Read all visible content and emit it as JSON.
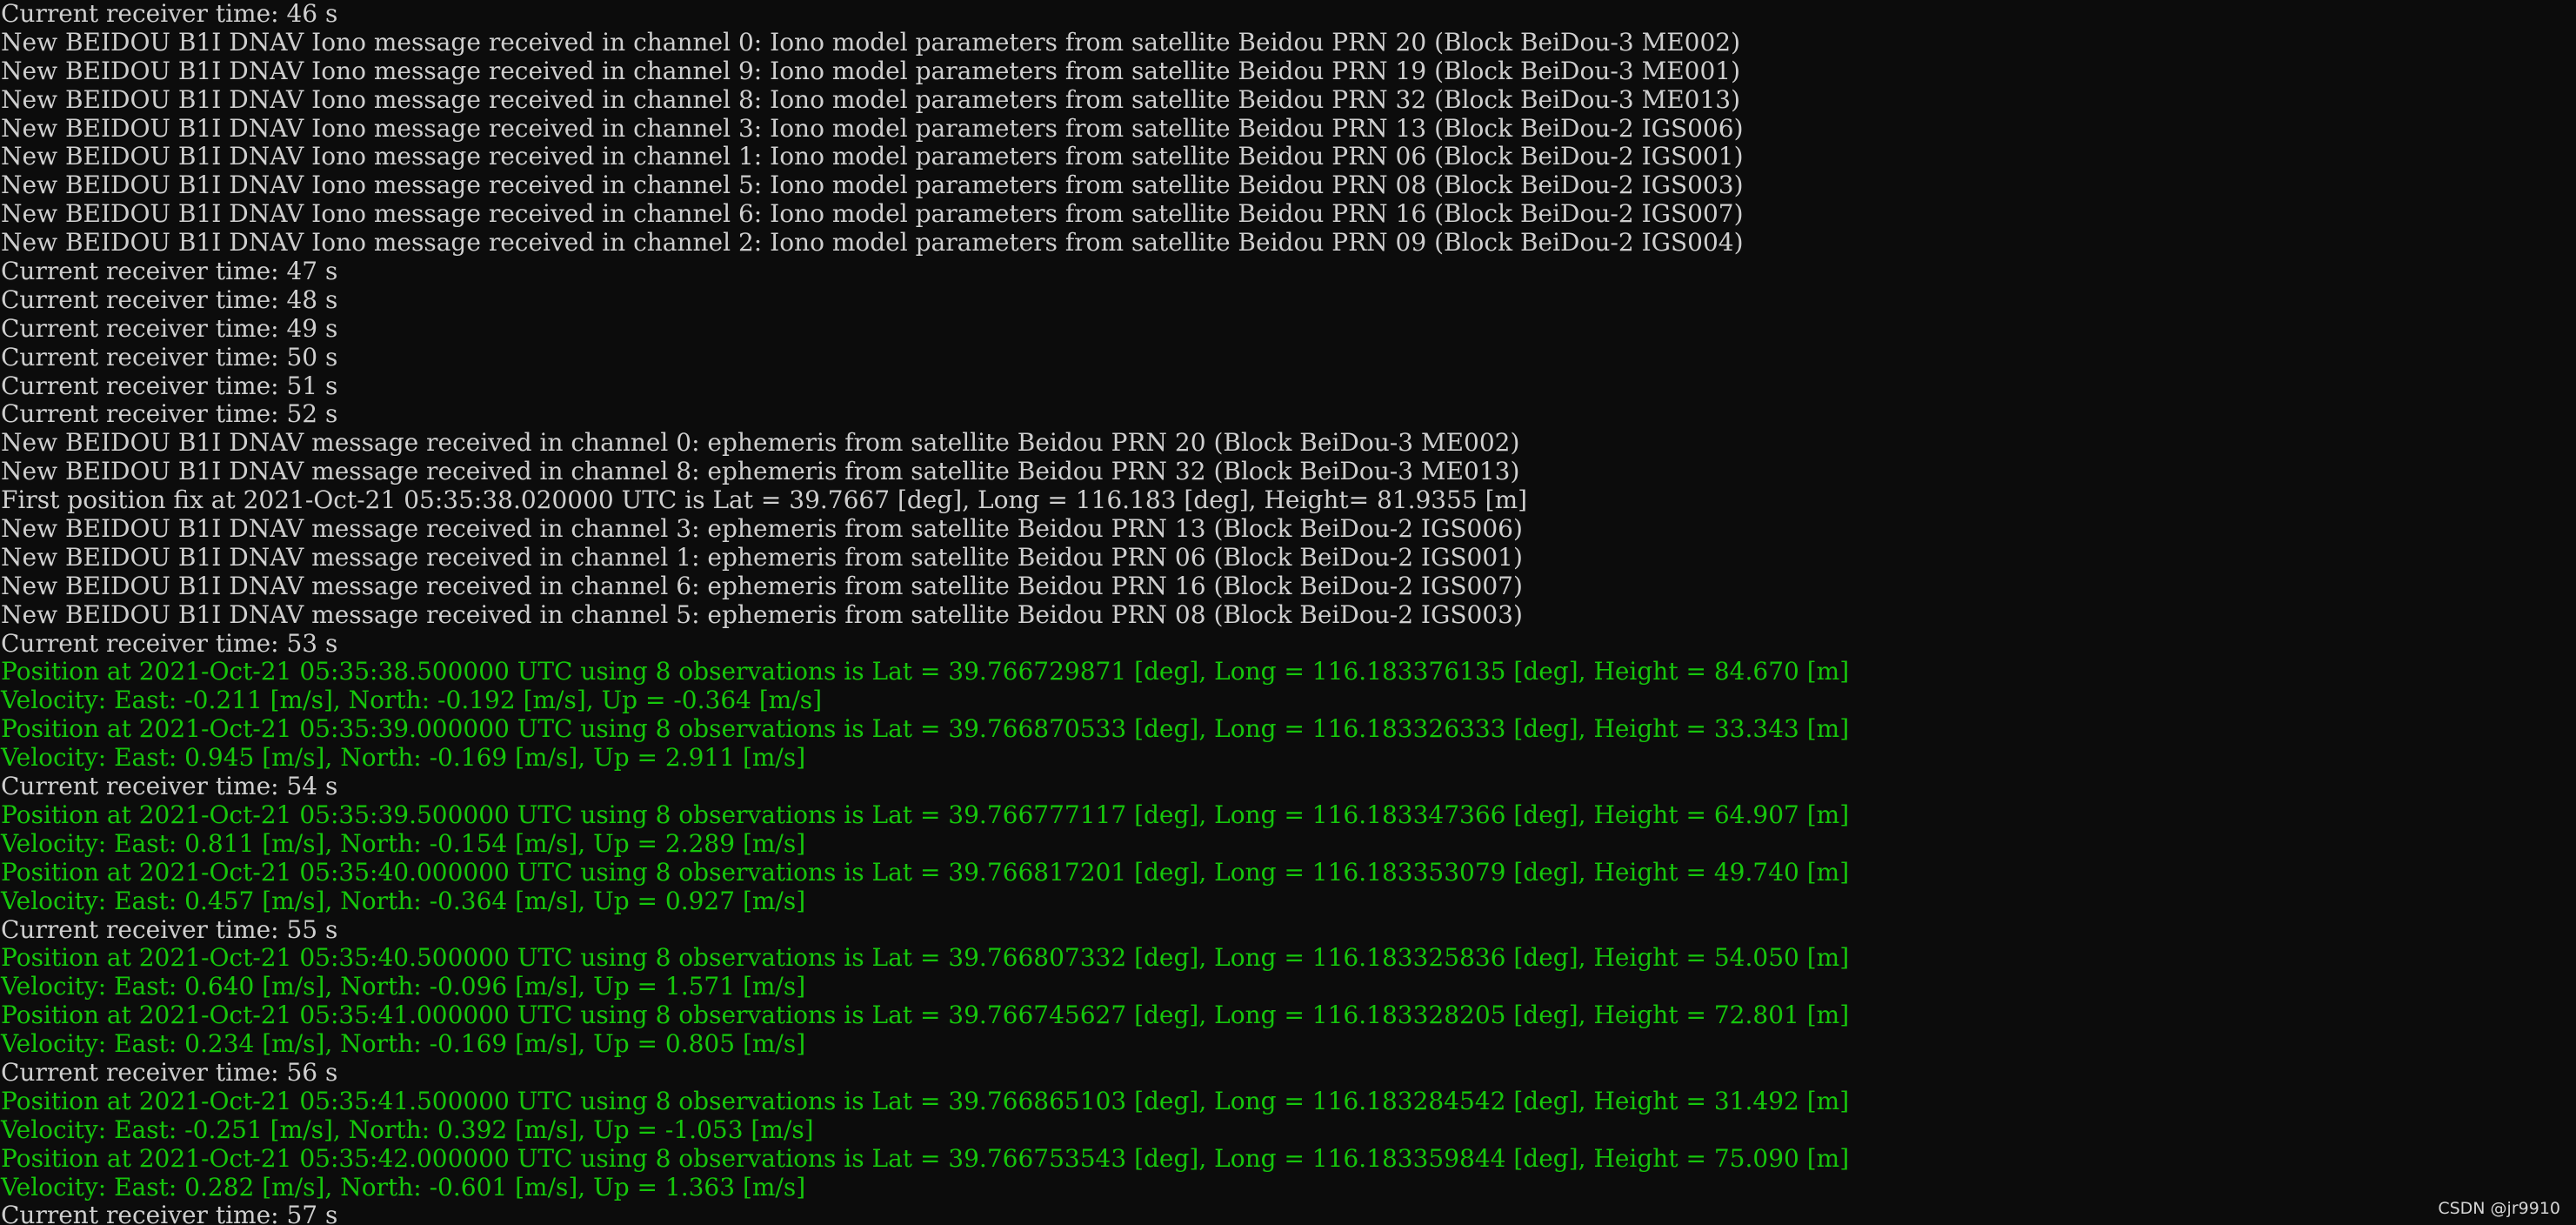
{
  "terminal": {
    "lines": [
      {
        "text": "Current receiver time: 46 s",
        "color": "white"
      },
      {
        "text": "New BEIDOU B1I DNAV Iono message received in channel 0: Iono model parameters from satellite Beidou PRN 20 (Block BeiDou-3 ME002)",
        "color": "white"
      },
      {
        "text": "New BEIDOU B1I DNAV Iono message received in channel 9: Iono model parameters from satellite Beidou PRN 19 (Block BeiDou-3 ME001)",
        "color": "white"
      },
      {
        "text": "New BEIDOU B1I DNAV Iono message received in channel 8: Iono model parameters from satellite Beidou PRN 32 (Block BeiDou-3 ME013)",
        "color": "white"
      },
      {
        "text": "New BEIDOU B1I DNAV Iono message received in channel 3: Iono model parameters from satellite Beidou PRN 13 (Block BeiDou-2 IGS006)",
        "color": "white"
      },
      {
        "text": "New BEIDOU B1I DNAV Iono message received in channel 1: Iono model parameters from satellite Beidou PRN 06 (Block BeiDou-2 IGS001)",
        "color": "white"
      },
      {
        "text": "New BEIDOU B1I DNAV Iono message received in channel 5: Iono model parameters from satellite Beidou PRN 08 (Block BeiDou-2 IGS003)",
        "color": "white"
      },
      {
        "text": "New BEIDOU B1I DNAV Iono message received in channel 6: Iono model parameters from satellite Beidou PRN 16 (Block BeiDou-2 IGS007)",
        "color": "white"
      },
      {
        "text": "New BEIDOU B1I DNAV Iono message received in channel 2: Iono model parameters from satellite Beidou PRN 09 (Block BeiDou-2 IGS004)",
        "color": "white"
      },
      {
        "text": "Current receiver time: 47 s",
        "color": "white"
      },
      {
        "text": "Current receiver time: 48 s",
        "color": "white"
      },
      {
        "text": "Current receiver time: 49 s",
        "color": "white"
      },
      {
        "text": "Current receiver time: 50 s",
        "color": "white"
      },
      {
        "text": "Current receiver time: 51 s",
        "color": "white"
      },
      {
        "text": "Current receiver time: 52 s",
        "color": "white"
      },
      {
        "text": "New BEIDOU B1I DNAV message received in channel 0: ephemeris from satellite Beidou PRN 20 (Block BeiDou-3 ME002)",
        "color": "white"
      },
      {
        "text": "New BEIDOU B1I DNAV message received in channel 8: ephemeris from satellite Beidou PRN 32 (Block BeiDou-3 ME013)",
        "color": "white"
      },
      {
        "text": "First position fix at 2021-Oct-21 05:35:38.020000 UTC is Lat = 39.7667 [deg], Long = 116.183 [deg], Height= 81.9355 [m]",
        "color": "white"
      },
      {
        "text": "New BEIDOU B1I DNAV message received in channel 3: ephemeris from satellite Beidou PRN 13 (Block BeiDou-2 IGS006)",
        "color": "white"
      },
      {
        "text": "New BEIDOU B1I DNAV message received in channel 1: ephemeris from satellite Beidou PRN 06 (Block BeiDou-2 IGS001)",
        "color": "white"
      },
      {
        "text": "New BEIDOU B1I DNAV message received in channel 6: ephemeris from satellite Beidou PRN 16 (Block BeiDou-2 IGS007)",
        "color": "white"
      },
      {
        "text": "New BEIDOU B1I DNAV message received in channel 5: ephemeris from satellite Beidou PRN 08 (Block BeiDou-2 IGS003)",
        "color": "white"
      },
      {
        "text": "Current receiver time: 53 s",
        "color": "white"
      },
      {
        "text": "Position at 2021-Oct-21 05:35:38.500000 UTC using 8 observations is Lat = 39.766729871 [deg], Long = 116.183376135 [deg], Height = 84.670 [m]",
        "color": "green"
      },
      {
        "text": "Velocity: East: -0.211 [m/s], North: -0.192 [m/s], Up = -0.364 [m/s]",
        "color": "green"
      },
      {
        "text": "Position at 2021-Oct-21 05:35:39.000000 UTC using 8 observations is Lat = 39.766870533 [deg], Long = 116.183326333 [deg], Height = 33.343 [m]",
        "color": "green"
      },
      {
        "text": "Velocity: East: 0.945 [m/s], North: -0.169 [m/s], Up = 2.911 [m/s]",
        "color": "green"
      },
      {
        "text": "Current receiver time: 54 s",
        "color": "white"
      },
      {
        "text": "Position at 2021-Oct-21 05:35:39.500000 UTC using 8 observations is Lat = 39.766777117 [deg], Long = 116.183347366 [deg], Height = 64.907 [m]",
        "color": "green"
      },
      {
        "text": "Velocity: East: 0.811 [m/s], North: -0.154 [m/s], Up = 2.289 [m/s]",
        "color": "green"
      },
      {
        "text": "Position at 2021-Oct-21 05:35:40.000000 UTC using 8 observations is Lat = 39.766817201 [deg], Long = 116.183353079 [deg], Height = 49.740 [m]",
        "color": "green"
      },
      {
        "text": "Velocity: East: 0.457 [m/s], North: -0.364 [m/s], Up = 0.927 [m/s]",
        "color": "green"
      },
      {
        "text": "Current receiver time: 55 s",
        "color": "white"
      },
      {
        "text": "Position at 2021-Oct-21 05:35:40.500000 UTC using 8 observations is Lat = 39.766807332 [deg], Long = 116.183325836 [deg], Height = 54.050 [m]",
        "color": "green"
      },
      {
        "text": "Velocity: East: 0.640 [m/s], North: -0.096 [m/s], Up = 1.571 [m/s]",
        "color": "green"
      },
      {
        "text": "Position at 2021-Oct-21 05:35:41.000000 UTC using 8 observations is Lat = 39.766745627 [deg], Long = 116.183328205 [deg], Height = 72.801 [m]",
        "color": "green"
      },
      {
        "text": "Velocity: East: 0.234 [m/s], North: -0.169 [m/s], Up = 0.805 [m/s]",
        "color": "green"
      },
      {
        "text": "Current receiver time: 56 s",
        "color": "white"
      },
      {
        "text": "Position at 2021-Oct-21 05:35:41.500000 UTC using 8 observations is Lat = 39.766865103 [deg], Long = 116.183284542 [deg], Height = 31.492 [m]",
        "color": "green"
      },
      {
        "text": "Velocity: East: -0.251 [m/s], North: 0.392 [m/s], Up = -1.053 [m/s]",
        "color": "green"
      },
      {
        "text": "Position at 2021-Oct-21 05:35:42.000000 UTC using 8 observations is Lat = 39.766753543 [deg], Long = 116.183359844 [deg], Height = 75.090 [m]",
        "color": "green"
      },
      {
        "text": "Velocity: East: 0.282 [m/s], North: -0.601 [m/s], Up = 1.363 [m/s]",
        "color": "green"
      },
      {
        "text": "Current receiver time: 57 s",
        "color": "white"
      }
    ]
  },
  "watermark": "CSDN @jr9910",
  "colors": {
    "background": "#0c0c0c",
    "text_default": "#cfcfcf",
    "text_position": "#16c60c"
  }
}
